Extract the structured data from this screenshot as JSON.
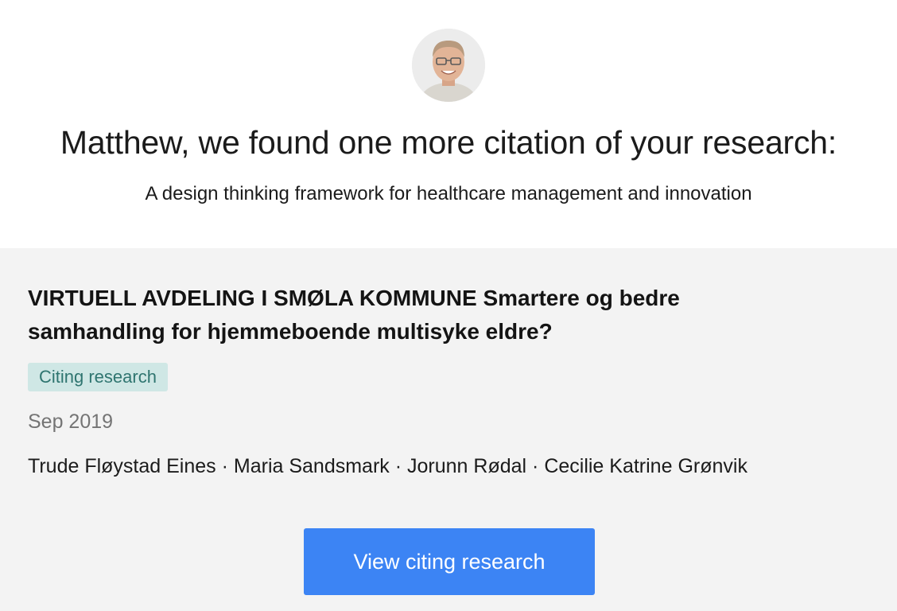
{
  "header": {
    "headline": "Matthew, we found one more citation of your research:",
    "subtitle": "A design thinking framework for healthcare management and innovation"
  },
  "citation": {
    "title": "VIRTUELL AVDELING I SMØLA KOMMUNE Smartere og bedre samhandling for hjemmeboende multisyke eldre?",
    "badge": "Citing research",
    "date": "Sep 2019",
    "authors": [
      "Trude Fløystad Eines",
      "Maria Sandsmark",
      "Jorunn Rødal",
      "Cecilie Katrine Grønvik"
    ],
    "author_separator": " · "
  },
  "actions": {
    "view_label": "View citing research"
  },
  "colors": {
    "card_background": "#f3f3f3",
    "badge_background": "#cfe7e5",
    "badge_text": "#2f7570",
    "button_background": "#3c84f4",
    "date_text": "#747474"
  }
}
